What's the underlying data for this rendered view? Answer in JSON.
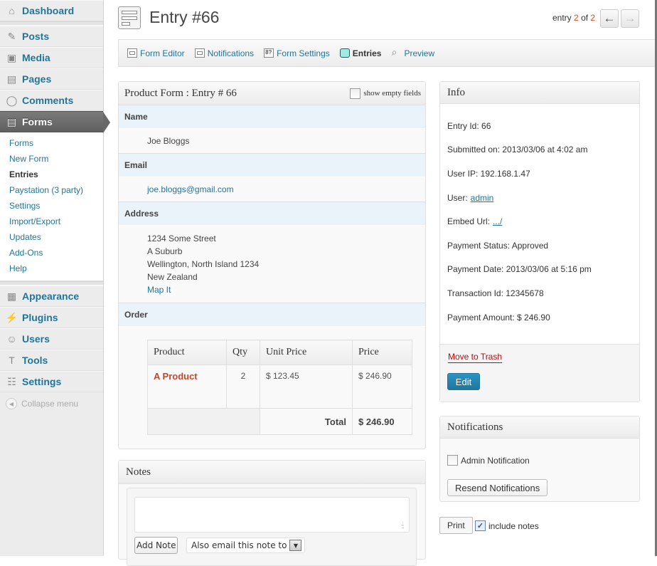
{
  "sidebar": {
    "items": [
      {
        "label": "Dashboard",
        "icon": "home-icon"
      },
      {
        "label": "Posts",
        "icon": "pin-icon"
      },
      {
        "label": "Media",
        "icon": "media-icon"
      },
      {
        "label": "Pages",
        "icon": "pages-icon"
      },
      {
        "label": "Comments",
        "icon": "comment-icon"
      },
      {
        "label": "Forms",
        "icon": "forms-icon",
        "current": true
      },
      {
        "label": "Appearance",
        "icon": "appearance-icon"
      },
      {
        "label": "Plugins",
        "icon": "plug-icon"
      },
      {
        "label": "Users",
        "icon": "users-icon"
      },
      {
        "label": "Tools",
        "icon": "tools-icon"
      },
      {
        "label": "Settings",
        "icon": "settings-icon"
      }
    ],
    "submenu": [
      {
        "label": "Forms"
      },
      {
        "label": "New Form"
      },
      {
        "label": "Entries",
        "current": true
      },
      {
        "label": "Paystation (3 party)"
      },
      {
        "label": "Settings"
      },
      {
        "label": "Import/Export"
      },
      {
        "label": "Updates"
      },
      {
        "label": "Add-Ons"
      },
      {
        "label": "Help"
      }
    ],
    "collapse_label": "Collapse menu"
  },
  "header": {
    "title": "Entry #66",
    "counter_prefix": "entry",
    "current_entry": "2",
    "counter_of": "of",
    "total_entries": "2"
  },
  "toolbar": {
    "items": [
      {
        "label": "Form Editor"
      },
      {
        "label": "Notifications"
      },
      {
        "label": "Form Settings"
      },
      {
        "label": "Entries",
        "current": true
      },
      {
        "label": "Preview"
      }
    ]
  },
  "entry": {
    "title": "Product Form : Entry # 66",
    "show_empty_label": "show empty fields",
    "show_empty_checked": false,
    "fields": {
      "name_label": "Name",
      "name_value": "Joe Bloggs",
      "email_label": "Email",
      "email_value": "joe.bloggs@gmail.com",
      "address_label": "Address",
      "address_lines": [
        "1234 Some Street",
        "A Suburb",
        "Wellington, North Island 1234",
        "New Zealand"
      ],
      "map_link": "Map It",
      "order_label": "Order"
    },
    "order": {
      "headers": [
        "Product",
        "Qty",
        "Unit Price",
        "Price"
      ],
      "rows": [
        {
          "product": "A Product",
          "qty": "2",
          "unit_price": "$ 123.45",
          "price": "$ 246.90"
        }
      ],
      "total_label": "Total",
      "total_value": "$ 246.90"
    }
  },
  "notes": {
    "title": "Notes",
    "textarea_value": "",
    "add_note_label": "Add Note",
    "email_select_value": "Also email this note to"
  },
  "info": {
    "title": "Info",
    "entry_id": "Entry Id: 66",
    "submitted_on": "Submitted on: 2013/03/06 at 4:02 am",
    "user_ip": "User IP: 192.168.1.47",
    "user_label": "User:",
    "user_link": "admin",
    "embed_label": "Embed Url:",
    "embed_link": ".../",
    "payment_status": "Payment Status: Approved",
    "payment_date": "Payment Date: 2013/03/06 at 5:16 pm",
    "transaction_id": "Transaction Id: 12345678",
    "payment_amount": "Payment Amount: $ 246.90",
    "trash_label": "Move to Trash",
    "edit_label": "Edit"
  },
  "notifications": {
    "title": "Notifications",
    "admin_label": "Admin Notification",
    "admin_checked": false,
    "resend_label": "Resend Notifications"
  },
  "print": {
    "button_label": "Print",
    "include_notes_label": "include notes",
    "include_notes_checked": true
  },
  "colors": {
    "link": "#21759b",
    "accent_red": "#d54e21",
    "trash": "#bc0b0b",
    "product": "#c0462e",
    "field_label_bg": "#eaf2fa"
  }
}
